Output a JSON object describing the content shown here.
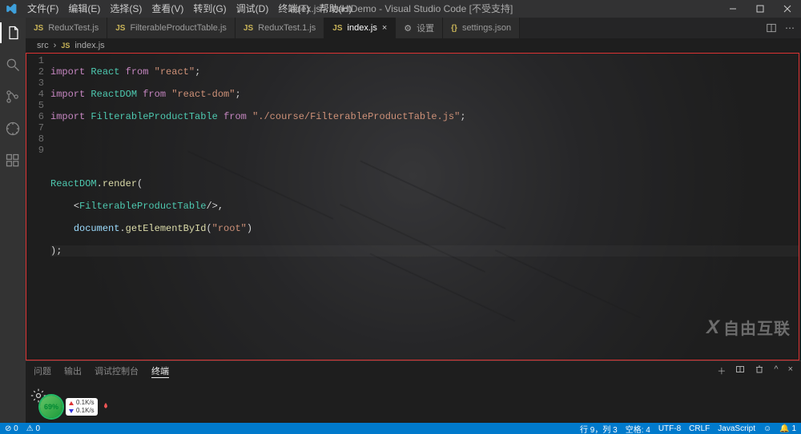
{
  "title": "index.js - reactDemo - Visual Studio Code [不受支持]",
  "menu": {
    "file": "文件(F)",
    "edit": "编辑(E)",
    "select": "选择(S)",
    "view": "查看(V)",
    "goto": "转到(G)",
    "debug": "调试(D)",
    "terminal": "终端(T)",
    "help": "帮助(H)"
  },
  "tabs": [
    {
      "icon": "js",
      "label": "ReduxTest.js",
      "active": false
    },
    {
      "icon": "js",
      "label": "FilterableProductTable.js",
      "active": false
    },
    {
      "icon": "js",
      "label": "ReduxTest.1.js",
      "active": false
    },
    {
      "icon": "js",
      "label": "index.js",
      "active": true,
      "close": true
    },
    {
      "icon": "gear",
      "label": "设置",
      "active": false
    },
    {
      "icon": "json",
      "label": "settings.json",
      "active": false
    }
  ],
  "breadcrumbs": {
    "root": "src",
    "file": "index.js"
  },
  "lines": {
    "1": "import React from \"react\";",
    "2": "import ReactDOM from \"react-dom\";",
    "3": "import FilterableProductTable from \"./course/FilterableProductTable.js\";",
    "4": "",
    "5": "",
    "6": "ReactDOM.render(",
    "7": "    <FilterableProductTable/>,",
    "8": "    document.getElementById(\"root\")",
    "9": ");"
  },
  "panel": {
    "problems": "问题",
    "output": "输出",
    "debugconsole": "调试控制台",
    "terminal": "终端"
  },
  "floater": {
    "pct": "69%",
    "up": "0.1K/s",
    "dn": "0.1K/s"
  },
  "watermark": "自由互联",
  "status": {
    "errors": "0",
    "warnings": "0",
    "ln": "行 9，列 3",
    "spaces": "空格: 4",
    "enc": "UTF-8",
    "eol": "CRLF",
    "lang": "JavaScript",
    "smiley": "☺",
    "notify": "1"
  }
}
